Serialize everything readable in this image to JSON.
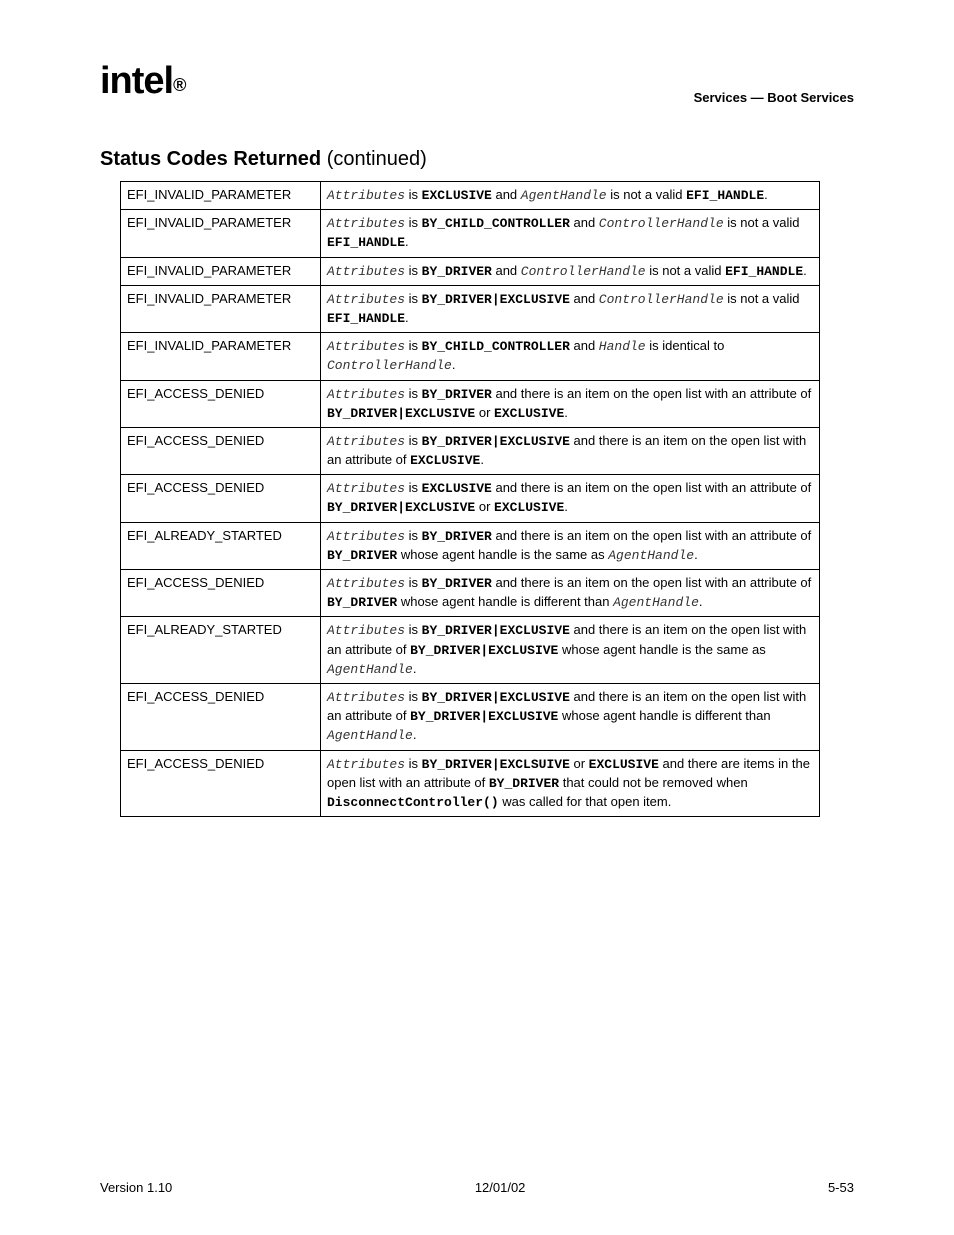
{
  "header": {
    "brand": "intel",
    "section": "Services — Boot Services"
  },
  "title": {
    "main": "Status Codes Returned",
    "suffix": " (continued)"
  },
  "rows": [
    {
      "code": "EFI_INVALID_PARAMETER",
      "desc": [
        {
          "t": "mi",
          "v": "Attributes"
        },
        {
          "t": "r",
          "v": " is "
        },
        {
          "t": "mb",
          "v": "EXCLUSIVE"
        },
        {
          "t": "r",
          "v": " and "
        },
        {
          "t": "mi",
          "v": "AgentHandle"
        },
        {
          "t": "r",
          "v": " is not a valid "
        },
        {
          "t": "mb",
          "v": "EFI_HANDLE"
        },
        {
          "t": "r",
          "v": "."
        }
      ]
    },
    {
      "code": "EFI_INVALID_PARAMETER",
      "desc": [
        {
          "t": "mi",
          "v": "Attributes"
        },
        {
          "t": "r",
          "v": " is "
        },
        {
          "t": "mb",
          "v": "BY_CHILD_CONTROLLER"
        },
        {
          "t": "r",
          "v": " and "
        },
        {
          "t": "mi",
          "v": "ControllerHandle"
        },
        {
          "t": "r",
          "v": " is not a valid "
        },
        {
          "t": "mb",
          "v": "EFI_HANDLE"
        },
        {
          "t": "r",
          "v": "."
        }
      ]
    },
    {
      "code": "EFI_INVALID_PARAMETER",
      "desc": [
        {
          "t": "mi",
          "v": "Attributes"
        },
        {
          "t": "r",
          "v": " is "
        },
        {
          "t": "mb",
          "v": "BY_DRIVER"
        },
        {
          "t": "r",
          "v": " and "
        },
        {
          "t": "mi",
          "v": "ControllerHandle"
        },
        {
          "t": "r",
          "v": " is not a valid "
        },
        {
          "t": "mb",
          "v": "EFI_HANDLE"
        },
        {
          "t": "r",
          "v": "."
        }
      ]
    },
    {
      "code": "EFI_INVALID_PARAMETER",
      "desc": [
        {
          "t": "mi",
          "v": "Attributes"
        },
        {
          "t": "r",
          "v": " is "
        },
        {
          "t": "mb",
          "v": "BY_DRIVER|EXCLUSIVE"
        },
        {
          "t": "r",
          "v": " and "
        },
        {
          "t": "mi",
          "v": "ControllerHandle"
        },
        {
          "t": "r",
          "v": " is not a valid "
        },
        {
          "t": "mb",
          "v": "EFI_HANDLE"
        },
        {
          "t": "r",
          "v": "."
        }
      ]
    },
    {
      "code": "EFI_INVALID_PARAMETER",
      "desc": [
        {
          "t": "mi",
          "v": "Attributes"
        },
        {
          "t": "r",
          "v": " is "
        },
        {
          "t": "mb",
          "v": "BY_CHILD_CONTROLLER"
        },
        {
          "t": "r",
          "v": " and "
        },
        {
          "t": "mi",
          "v": "Handle"
        },
        {
          "t": "r",
          "v": " is identical to "
        },
        {
          "t": "mi",
          "v": "ControllerHandle"
        },
        {
          "t": "r",
          "v": "."
        }
      ]
    },
    {
      "code": "EFI_ACCESS_DENIED",
      "desc": [
        {
          "t": "mi",
          "v": "Attributes"
        },
        {
          "t": "r",
          "v": " is "
        },
        {
          "t": "mb",
          "v": "BY_DRIVER"
        },
        {
          "t": "r",
          "v": " and there is an item on the open list with an attribute of "
        },
        {
          "t": "mb",
          "v": "BY_DRIVER|EXCLUSIVE"
        },
        {
          "t": "r",
          "v": " or "
        },
        {
          "t": "mb",
          "v": "EXCLUSIVE"
        },
        {
          "t": "r",
          "v": "."
        }
      ]
    },
    {
      "code": "EFI_ACCESS_DENIED",
      "desc": [
        {
          "t": "mi",
          "v": "Attributes"
        },
        {
          "t": "r",
          "v": " is "
        },
        {
          "t": "mb",
          "v": "BY_DRIVER|EXCLUSIVE"
        },
        {
          "t": "r",
          "v": " and there is an item on the open list with an attribute of "
        },
        {
          "t": "mb",
          "v": "EXCLUSIVE"
        },
        {
          "t": "r",
          "v": "."
        }
      ]
    },
    {
      "code": "EFI_ACCESS_DENIED",
      "desc": [
        {
          "t": "mi",
          "v": "Attributes"
        },
        {
          "t": "r",
          "v": " is "
        },
        {
          "t": "mb",
          "v": "EXCLUSIVE"
        },
        {
          "t": "r",
          "v": " and there is an item on the open list with an attribute of "
        },
        {
          "t": "mb",
          "v": "BY_DRIVER|EXCLUSIVE"
        },
        {
          "t": "r",
          "v": " or "
        },
        {
          "t": "mb",
          "v": "EXCLUSIVE"
        },
        {
          "t": "r",
          "v": "."
        }
      ]
    },
    {
      "code": "EFI_ALREADY_STARTED",
      "desc": [
        {
          "t": "mi",
          "v": "Attributes"
        },
        {
          "t": "r",
          "v": " is "
        },
        {
          "t": "mb",
          "v": "BY_DRIVER"
        },
        {
          "t": "r",
          "v": " and there is an item on the open list with an attribute of "
        },
        {
          "t": "mb",
          "v": "BY_DRIVER"
        },
        {
          "t": "r",
          "v": " whose agent handle is the same as "
        },
        {
          "t": "mi",
          "v": "AgentHandle"
        },
        {
          "t": "r",
          "v": "."
        }
      ]
    },
    {
      "code": "EFI_ACCESS_DENIED",
      "desc": [
        {
          "t": "mi",
          "v": "Attributes"
        },
        {
          "t": "r",
          "v": " is "
        },
        {
          "t": "mb",
          "v": "BY_DRIVER"
        },
        {
          "t": "r",
          "v": " and there is an item on the open list with an attribute of "
        },
        {
          "t": "mb",
          "v": "BY_DRIVER"
        },
        {
          "t": "r",
          "v": " whose agent handle is different than "
        },
        {
          "t": "mi",
          "v": "AgentHandle"
        },
        {
          "t": "r",
          "v": "."
        }
      ]
    },
    {
      "code": "EFI_ALREADY_STARTED",
      "desc": [
        {
          "t": "mi",
          "v": "Attributes"
        },
        {
          "t": "r",
          "v": " is "
        },
        {
          "t": "mb",
          "v": "BY_DRIVER|EXCLUSIVE"
        },
        {
          "t": "r",
          "v": " and there is an item on the open list with an attribute of "
        },
        {
          "t": "mb",
          "v": "BY_DRIVER|EXCLUSIVE"
        },
        {
          "t": "r",
          "v": " whose agent handle is the same as "
        },
        {
          "t": "mi",
          "v": "AgentHandle"
        },
        {
          "t": "r",
          "v": "."
        }
      ]
    },
    {
      "code": "EFI_ACCESS_DENIED",
      "desc": [
        {
          "t": "mi",
          "v": "Attributes"
        },
        {
          "t": "r",
          "v": " is "
        },
        {
          "t": "mb",
          "v": "BY_DRIVER|EXCLUSIVE"
        },
        {
          "t": "r",
          "v": " and there is an item on the open list with an attribute of "
        },
        {
          "t": "mb",
          "v": "BY_DRIVER|EXCLUSIVE"
        },
        {
          "t": "r",
          "v": " whose agent handle is different than "
        },
        {
          "t": "mi",
          "v": "AgentHandle"
        },
        {
          "t": "r",
          "v": "."
        }
      ]
    },
    {
      "code": "EFI_ACCESS_DENIED",
      "desc": [
        {
          "t": "mi",
          "v": "Attributes"
        },
        {
          "t": "r",
          "v": " is "
        },
        {
          "t": "mb",
          "v": "BY_DRIVER|EXCLSUIVE"
        },
        {
          "t": "r",
          "v": " or "
        },
        {
          "t": "mb",
          "v": "EXCLUSIVE"
        },
        {
          "t": "r",
          "v": " and there are items in the open list with an attribute of "
        },
        {
          "t": "mb",
          "v": "BY_DRIVER"
        },
        {
          "t": "r",
          "v": " that could not be removed when "
        },
        {
          "t": "mb",
          "v": "DisconnectController()"
        },
        {
          "t": "r",
          "v": " was called for that open item."
        }
      ]
    }
  ],
  "footer": {
    "left": "Version 1.10",
    "center": "12/01/02",
    "right": "5-53"
  }
}
